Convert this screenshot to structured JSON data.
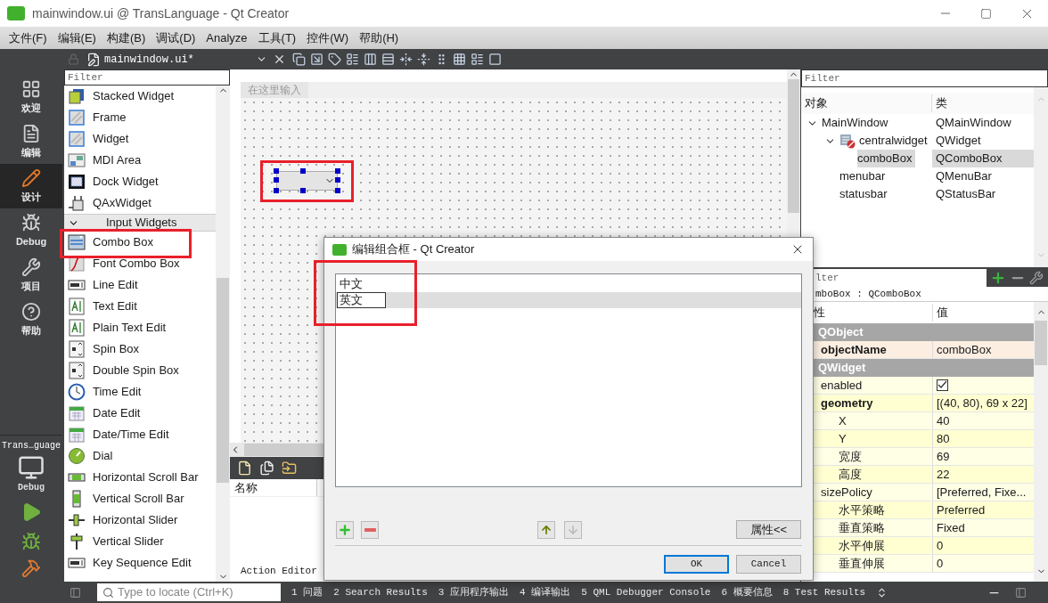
{
  "window": {
    "title": "mainwindow.ui @ TransLanguage - Qt Creator"
  },
  "menu": [
    "文件(F)",
    "编辑(E)",
    "构建(B)",
    "调试(D)",
    "Analyze",
    "工具(T)",
    "控件(W)",
    "帮助(H)"
  ],
  "editor_toolbar": {
    "file": "mainwindow.ui*"
  },
  "modes": [
    {
      "label": "欢迎",
      "kind": "welcome",
      "selected": false
    },
    {
      "label": "编辑",
      "kind": "edit",
      "selected": false
    },
    {
      "label": "设计",
      "kind": "design",
      "selected": true
    },
    {
      "label": "Debug",
      "kind": "debug",
      "selected": false
    },
    {
      "label": "项目",
      "kind": "projects",
      "selected": false
    },
    {
      "label": "帮助",
      "kind": "help",
      "selected": false
    }
  ],
  "target": {
    "project": "Trans…guage",
    "config": "Debug"
  },
  "widget_box": {
    "filter_placeholder": "Filter",
    "items": [
      {
        "kind": "item",
        "label": "Stacked Widget"
      },
      {
        "kind": "item",
        "label": "Frame"
      },
      {
        "kind": "item",
        "label": "Widget"
      },
      {
        "kind": "item",
        "label": "MDI Area"
      },
      {
        "kind": "item",
        "label": "Dock Widget"
      },
      {
        "kind": "item",
        "label": "QAxWidget"
      },
      {
        "kind": "category",
        "label": "Input Widgets",
        "expanded": true
      },
      {
        "kind": "item",
        "label": "Combo Box"
      },
      {
        "kind": "item",
        "label": "Font Combo Box"
      },
      {
        "kind": "item",
        "label": "Line Edit"
      },
      {
        "kind": "item",
        "label": "Text Edit"
      },
      {
        "kind": "item",
        "label": "Plain Text Edit"
      },
      {
        "kind": "item",
        "label": "Spin Box"
      },
      {
        "kind": "item",
        "label": "Double Spin Box"
      },
      {
        "kind": "item",
        "label": "Time Edit"
      },
      {
        "kind": "item",
        "label": "Date Edit"
      },
      {
        "kind": "item",
        "label": "Date/Time Edit"
      },
      {
        "kind": "item",
        "label": "Dial"
      },
      {
        "kind": "item",
        "label": "Horizontal Scroll Bar"
      },
      {
        "kind": "item",
        "label": "Vertical Scroll Bar"
      },
      {
        "kind": "item",
        "label": "Horizontal Slider"
      },
      {
        "kind": "item",
        "label": "Vertical Slider"
      },
      {
        "kind": "item",
        "label": "Key Sequence Edit"
      }
    ]
  },
  "form": {
    "menu_placeholder": "在这里输入",
    "combo_selected": true
  },
  "action_editor": {
    "column": "名称",
    "tab": "Action Editor"
  },
  "object_inspector": {
    "filter_placeholder": "Filter",
    "columns": [
      "对象",
      "类"
    ],
    "tree": [
      {
        "name": "MainWindow",
        "class": "QMainWindow",
        "expanded": true,
        "selected": false,
        "children": [
          {
            "name": "centralwidget",
            "class": "QWidget",
            "kind": "layout",
            "expanded": true,
            "selected": false,
            "children": [
              {
                "name": "comboBox",
                "class": "QComboBox",
                "selected": true
              }
            ]
          },
          {
            "name": "menubar",
            "class": "QMenuBar",
            "selected": false
          },
          {
            "name": "statusbar",
            "class": "QStatusBar",
            "selected": false
          }
        ]
      }
    ]
  },
  "property_editor": {
    "filter_placeholder": "lter",
    "object": "mboBox : QComboBox",
    "columns": [
      "性",
      "值"
    ],
    "rows": [
      {
        "kind": "group",
        "name": "QObject"
      },
      {
        "kind": "text",
        "name": "objectName",
        "value": "comboBox",
        "modified": true
      },
      {
        "kind": "group",
        "name": "QWidget"
      },
      {
        "kind": "check",
        "name": "enabled",
        "checked": true,
        "modified": false
      },
      {
        "kind": "text",
        "name": "geometry",
        "value": "[(40, 80), 69 x 22]",
        "modified": true,
        "children": [
          {
            "kind": "text",
            "name": "X",
            "value": "40",
            "modified": false
          },
          {
            "kind": "text",
            "name": "Y",
            "value": "80",
            "modified": false
          },
          {
            "kind": "text",
            "name": "宽度",
            "value": "69",
            "modified": false
          },
          {
            "kind": "text",
            "name": "高度",
            "value": "22",
            "modified": false
          }
        ]
      },
      {
        "kind": "text",
        "name": "sizePolicy",
        "value": "[Preferred, Fixe...",
        "modified": false,
        "children": [
          {
            "kind": "text",
            "name": "水平策略",
            "value": "Preferred",
            "modified": false
          },
          {
            "kind": "text",
            "name": "垂直策略",
            "value": "Fixed",
            "modified": false
          },
          {
            "kind": "text",
            "name": "水平伸展",
            "value": "0",
            "modified": false
          },
          {
            "kind": "text",
            "name": "垂直伸展",
            "value": "0",
            "modified": false
          }
        ]
      }
    ]
  },
  "dialog": {
    "title": "编辑组合框 - Qt Creator",
    "items": [
      {
        "text": "中文",
        "selected": false,
        "editing": false
      },
      {
        "text": "英文",
        "selected": true,
        "editing": true
      }
    ],
    "move_down_disabled": true,
    "properties_button": "属性<<",
    "ok": "OK",
    "cancel": "Cancel"
  },
  "status_bar": {
    "locate_placeholder": "Type to locate (Ctrl+K)",
    "panes": [
      "1 问题",
      "2 Search Results",
      "3 应用程序输出",
      "4 编译输出",
      "5 QML Debugger Console",
      "6 概要信息",
      "8 Test Results"
    ]
  }
}
